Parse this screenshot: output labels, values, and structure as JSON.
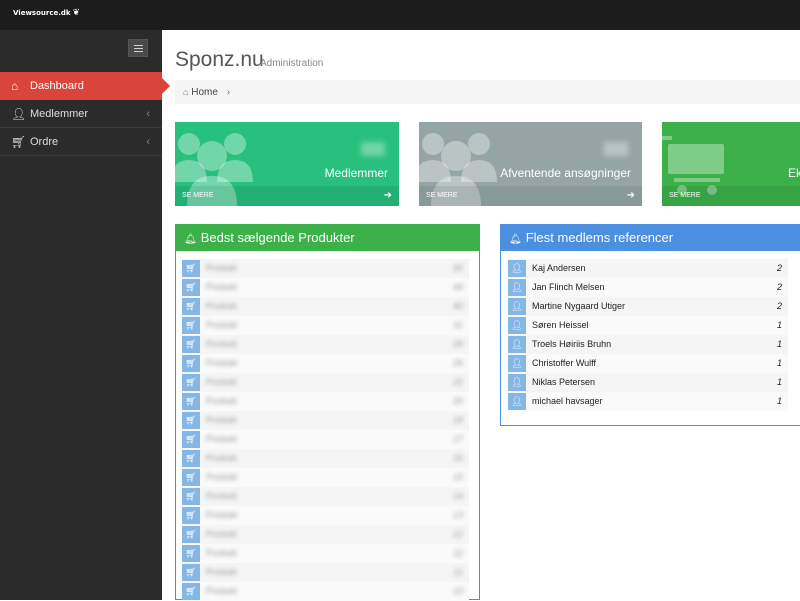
{
  "app": {
    "logo_text": "Viewsource.dk"
  },
  "sidebar": {
    "items": [
      {
        "label": "Dashboard",
        "icon": "home-icon",
        "active": true
      },
      {
        "label": "Medlemmer",
        "icon": "user-icon"
      },
      {
        "label": "Ordre",
        "icon": "cart-icon"
      }
    ]
  },
  "header": {
    "title": "Sponz.nu",
    "subtitle": "Administration"
  },
  "breadcrumb": {
    "home": "Home"
  },
  "tiles": [
    {
      "label": "Medlemmer",
      "footer": "SE MERE",
      "color": "#27c07d"
    },
    {
      "label": "Afventende ansøgninger",
      "footer": "SE MERE",
      "color": "#95a5a6"
    },
    {
      "label": "Ek",
      "footer": "SE MERE",
      "color": "#3cb14a"
    }
  ],
  "products_panel": {
    "title": "Bedst sælgende Produkter",
    "color": "#3cb14a",
    "rows": [
      {
        "name": "Produkt",
        "value": "50"
      },
      {
        "name": "Produkt",
        "value": "44"
      },
      {
        "name": "Produkt",
        "value": "40"
      },
      {
        "name": "Produkt",
        "value": "31"
      },
      {
        "name": "Produkt",
        "value": "28"
      },
      {
        "name": "Produkt",
        "value": "26"
      },
      {
        "name": "Produkt",
        "value": "22"
      },
      {
        "name": "Produkt",
        "value": "20"
      },
      {
        "name": "Produkt",
        "value": "18"
      },
      {
        "name": "Produkt",
        "value": "17"
      },
      {
        "name": "Produkt",
        "value": "16"
      },
      {
        "name": "Produkt",
        "value": "15"
      },
      {
        "name": "Produkt",
        "value": "14"
      },
      {
        "name": "Produkt",
        "value": "13"
      },
      {
        "name": "Produkt",
        "value": "12"
      },
      {
        "name": "Produkt",
        "value": "12"
      },
      {
        "name": "Produkt",
        "value": "11"
      },
      {
        "name": "Produkt",
        "value": "10"
      }
    ]
  },
  "members_panel": {
    "title": "Flest medlems referencer",
    "color": "#4a8fe0",
    "rows": [
      {
        "name": "Kaj Andersen",
        "value": "2"
      },
      {
        "name": "Jan Flinch Melsen",
        "value": "2"
      },
      {
        "name": "Martine Nygaard Utiger",
        "value": "2"
      },
      {
        "name": "Søren Heissel",
        "value": "1"
      },
      {
        "name": "Troels Høiriis Bruhn",
        "value": "1"
      },
      {
        "name": "Christoffer Wulff",
        "value": "1"
      },
      {
        "name": "Niklas Petersen",
        "value": "1"
      },
      {
        "name": "michael havsager",
        "value": "1"
      }
    ]
  }
}
